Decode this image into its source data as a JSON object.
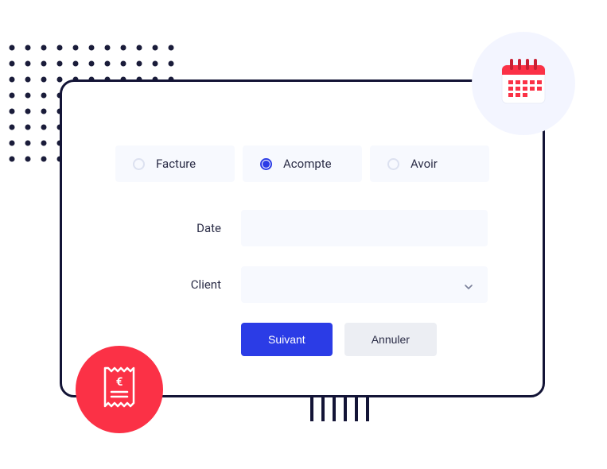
{
  "form": {
    "radios": {
      "facture": {
        "label": "Facture",
        "selected": false
      },
      "acompte": {
        "label": "Acompte",
        "selected": true
      },
      "avoir": {
        "label": "Avoir",
        "selected": false
      }
    },
    "fields": {
      "date_label": "Date",
      "client_label": "Client"
    },
    "buttons": {
      "primary": "Suivant",
      "secondary": "Annuler"
    }
  },
  "icons": {
    "calendar": "calendar-icon",
    "receipt": "receipt-icon",
    "barcode": "barcode-decoration",
    "dots": "dots-pattern"
  },
  "colors": {
    "primary": "#2b3ce6",
    "accent": "#fb3146",
    "frame": "#131436",
    "input_bg": "#f7f9fe"
  }
}
